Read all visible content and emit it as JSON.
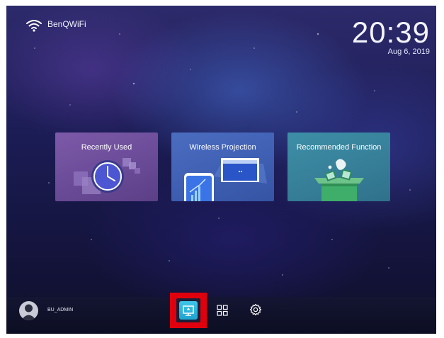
{
  "status": {
    "wifi_icon": "wifi-icon",
    "network_name": "BenQWiFi",
    "time": "20:39",
    "date": "Aug 6, 2019"
  },
  "nav": {
    "left_arrow": "›"
  },
  "cards": [
    {
      "label": "Recently Used",
      "icon": "clock-icon",
      "color": "#6a4b98"
    },
    {
      "label": "Wireless Projection",
      "icon": "phone-projection-icon",
      "color": "#3f5fb3"
    },
    {
      "label": "Recommended Function",
      "icon": "gift-box-icon",
      "color": "#377f99"
    }
  ],
  "bottom_bar": {
    "user_icon": "user-avatar-icon",
    "username": "BU_ADMIN",
    "buttons": [
      {
        "name": "projection",
        "icon": "input-source-icon",
        "selected": true
      },
      {
        "name": "apps",
        "icon": "grid-icon"
      },
      {
        "name": "settings",
        "icon": "gear-icon"
      }
    ],
    "highlight_color": "#e0000d"
  }
}
